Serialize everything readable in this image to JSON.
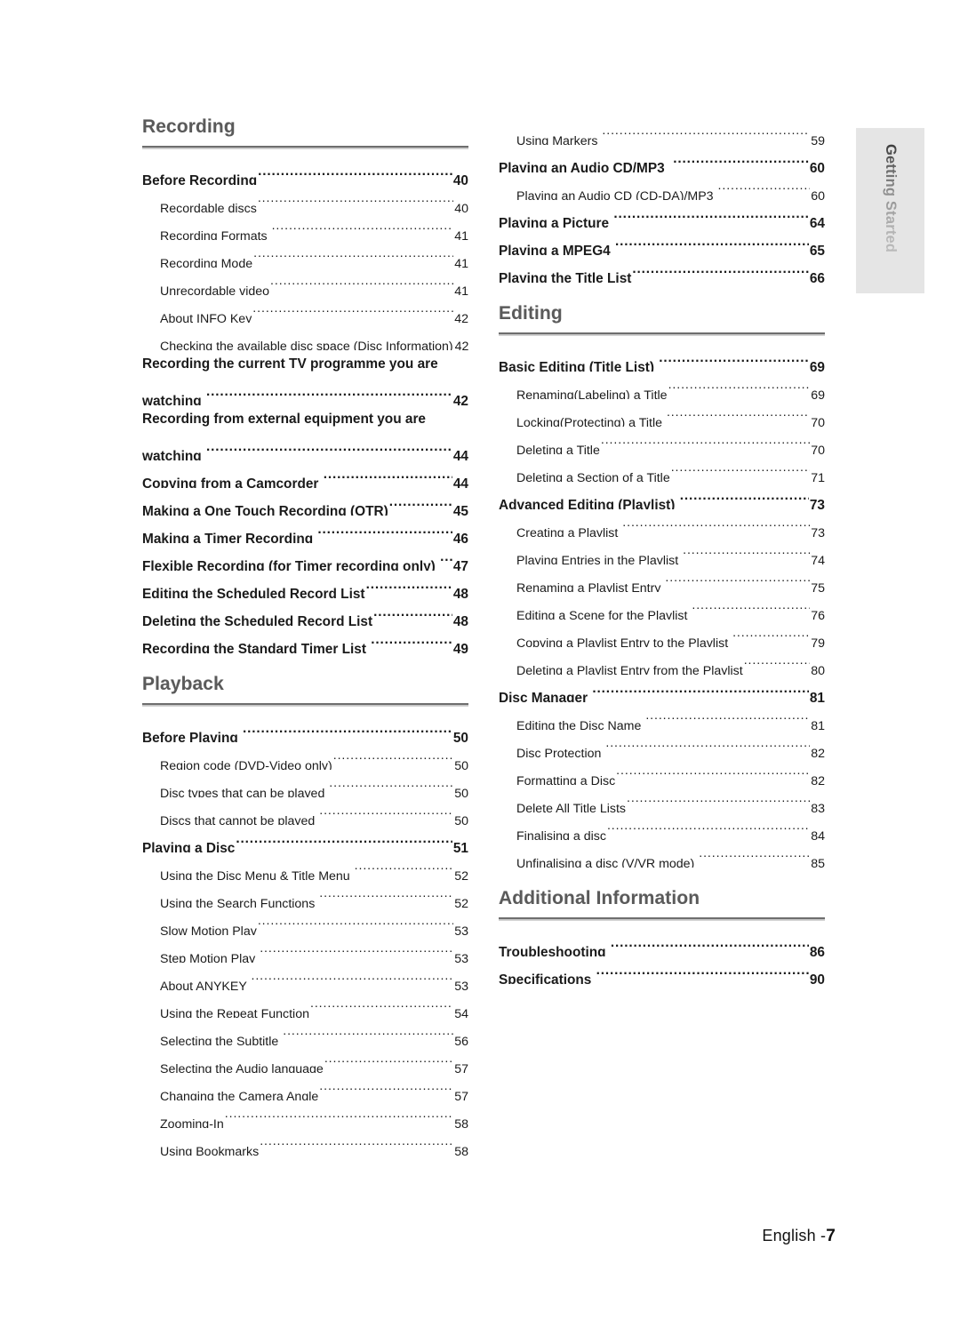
{
  "side_tab": {
    "label": "Getting Started"
  },
  "footer": {
    "language": "English -",
    "page": "7"
  },
  "columns": [
    {
      "sections": [
        {
          "title": "Recording",
          "entries": [
            {
              "level": 1,
              "text": "Before Recording",
              "page": "40"
            },
            {
              "level": 2,
              "text": "Recordable discs",
              "page": "40"
            },
            {
              "level": 2,
              "text": "Recording Formats ",
              "page": "41"
            },
            {
              "level": 2,
              "text": "Recording Mode",
              "page": "41"
            },
            {
              "level": 2,
              "text": "Unrecordable video",
              "page": "41"
            },
            {
              "level": 2,
              "text": "About INFO Key",
              "page": "42"
            },
            {
              "level": 2,
              "text": "Checking the available disc space (Disc Information)",
              "page": "42",
              "tight": true
            },
            {
              "level": 1,
              "text": "watching ",
              "page": "42",
              "first_line": "Recording the current TV programme you are"
            },
            {
              "level": 1,
              "text": "watching ",
              "page": "44",
              "first_line": "Recording from external equipment you are"
            },
            {
              "level": 1,
              "text": "Copying from a Camcorder ",
              "page": "44"
            },
            {
              "level": 1,
              "text": "Making a One Touch Recording (OTR)",
              "page": "45"
            },
            {
              "level": 1,
              "text": "Making a Timer Recording ",
              "page": "46"
            },
            {
              "level": 1,
              "text": "Flexible Recording (for Timer recording only) ",
              "page": "47",
              "tight": true
            },
            {
              "level": 1,
              "text": "Editing the Scheduled Record List",
              "page": "48"
            },
            {
              "level": 1,
              "text": "Deleting the Scheduled Record List",
              "page": "48"
            },
            {
              "level": 1,
              "text": "Recording the Standard Timer List ",
              "page": "49"
            }
          ]
        },
        {
          "title": "Playback",
          "entries": [
            {
              "level": 1,
              "text": "Before Playing ",
              "page": "50"
            },
            {
              "level": 2,
              "text": "Region code (DVD-Video only)",
              "page": "50"
            },
            {
              "level": 2,
              "text": "Disc types that can be played ",
              "page": "50"
            },
            {
              "level": 2,
              "text": "Discs that cannot be played ",
              "page": "50"
            },
            {
              "level": 1,
              "text": "Playing a Disc",
              "page": "51"
            },
            {
              "level": 2,
              "text": "Using the Disc Menu & Title Menu ",
              "page": "52"
            },
            {
              "level": 2,
              "text": "Using the Search Functions ",
              "page": "52"
            },
            {
              "level": 2,
              "text": "Slow Motion Play",
              "page": "53"
            },
            {
              "level": 2,
              "text": "Step Motion Play ",
              "page": "53"
            },
            {
              "level": 2,
              "text": "About ANYKEY ",
              "page": "53"
            },
            {
              "level": 2,
              "text": "Using the Repeat Function",
              "page": "54"
            },
            {
              "level": 2,
              "text": "Selecting the Subtitle ",
              "page": "56"
            },
            {
              "level": 2,
              "text": "Selecting the Audio language",
              "page": "57"
            },
            {
              "level": 2,
              "text": "Changing the Camera Angle",
              "page": "57"
            },
            {
              "level": 2,
              "text": "Zooming-In",
              "page": "58"
            },
            {
              "level": 2,
              "text": "Using Bookmarks",
              "page": "58"
            }
          ]
        }
      ]
    },
    {
      "sections": [
        {
          "title": null,
          "entries": [
            {
              "level": 2,
              "text": "Using Markers ",
              "page": "59"
            },
            {
              "level": 1,
              "text": "Playing an Audio CD/MP3  ",
              "page": "60"
            },
            {
              "level": 2,
              "text": "Playing an Audio CD (CD-DA)/MP3 ",
              "page": "60"
            },
            {
              "level": 1,
              "text": "Playing a Picture ",
              "page": "64"
            },
            {
              "level": 1,
              "text": "Playing a MPEG4 ",
              "page": "65"
            },
            {
              "level": 1,
              "text": "Playing the Title List",
              "page": "66"
            }
          ]
        },
        {
          "title": "Editing",
          "entries": [
            {
              "level": 1,
              "text": "Basic Editing (Title List) ",
              "page": "69"
            },
            {
              "level": 2,
              "text": "Renaming(Labeling) a Title",
              "page": "69"
            },
            {
              "level": 2,
              "text": "Locking(Protecting) a Title ",
              "page": "70"
            },
            {
              "level": 2,
              "text": "Deleting a Title",
              "page": "70"
            },
            {
              "level": 2,
              "text": "Deleting a Section of a Title",
              "page": "71"
            },
            {
              "level": 1,
              "text": "Advanced Editing (Playlist) ",
              "page": "73"
            },
            {
              "level": 2,
              "text": "Creating a Playlist ",
              "page": "73"
            },
            {
              "level": 2,
              "text": "Playing Entries in the Playlist ",
              "page": "74"
            },
            {
              "level": 2,
              "text": "Renaming a Playlist Entry ",
              "page": "75"
            },
            {
              "level": 2,
              "text": "Editing a Scene for the Playlist ",
              "page": "76"
            },
            {
              "level": 2,
              "text": "Copying a Playlist Entry to the Playlist ",
              "page": "79"
            },
            {
              "level": 2,
              "text": "Deleting a Playlist Entry from the Playlist",
              "page": "80"
            },
            {
              "level": 1,
              "text": "Disc Manager ",
              "page": "81"
            },
            {
              "level": 2,
              "text": "Editing the Disc Name ",
              "page": "81"
            },
            {
              "level": 2,
              "text": "Disc Protection ",
              "page": "82"
            },
            {
              "level": 2,
              "text": "Formatting a Disc",
              "page": "82"
            },
            {
              "level": 2,
              "text": "Delete All Title Lists",
              "page": "83"
            },
            {
              "level": 2,
              "text": "Finalising a disc",
              "page": "84"
            },
            {
              "level": 2,
              "text": "Unfinalising a disc (V/VR mode) ",
              "page": "85"
            }
          ]
        },
        {
          "title": "Additional Information",
          "entries": [
            {
              "level": 1,
              "text": "Troubleshooting ",
              "page": "86"
            },
            {
              "level": 1,
              "text": "Specifications ",
              "page": "90"
            }
          ]
        }
      ]
    }
  ]
}
